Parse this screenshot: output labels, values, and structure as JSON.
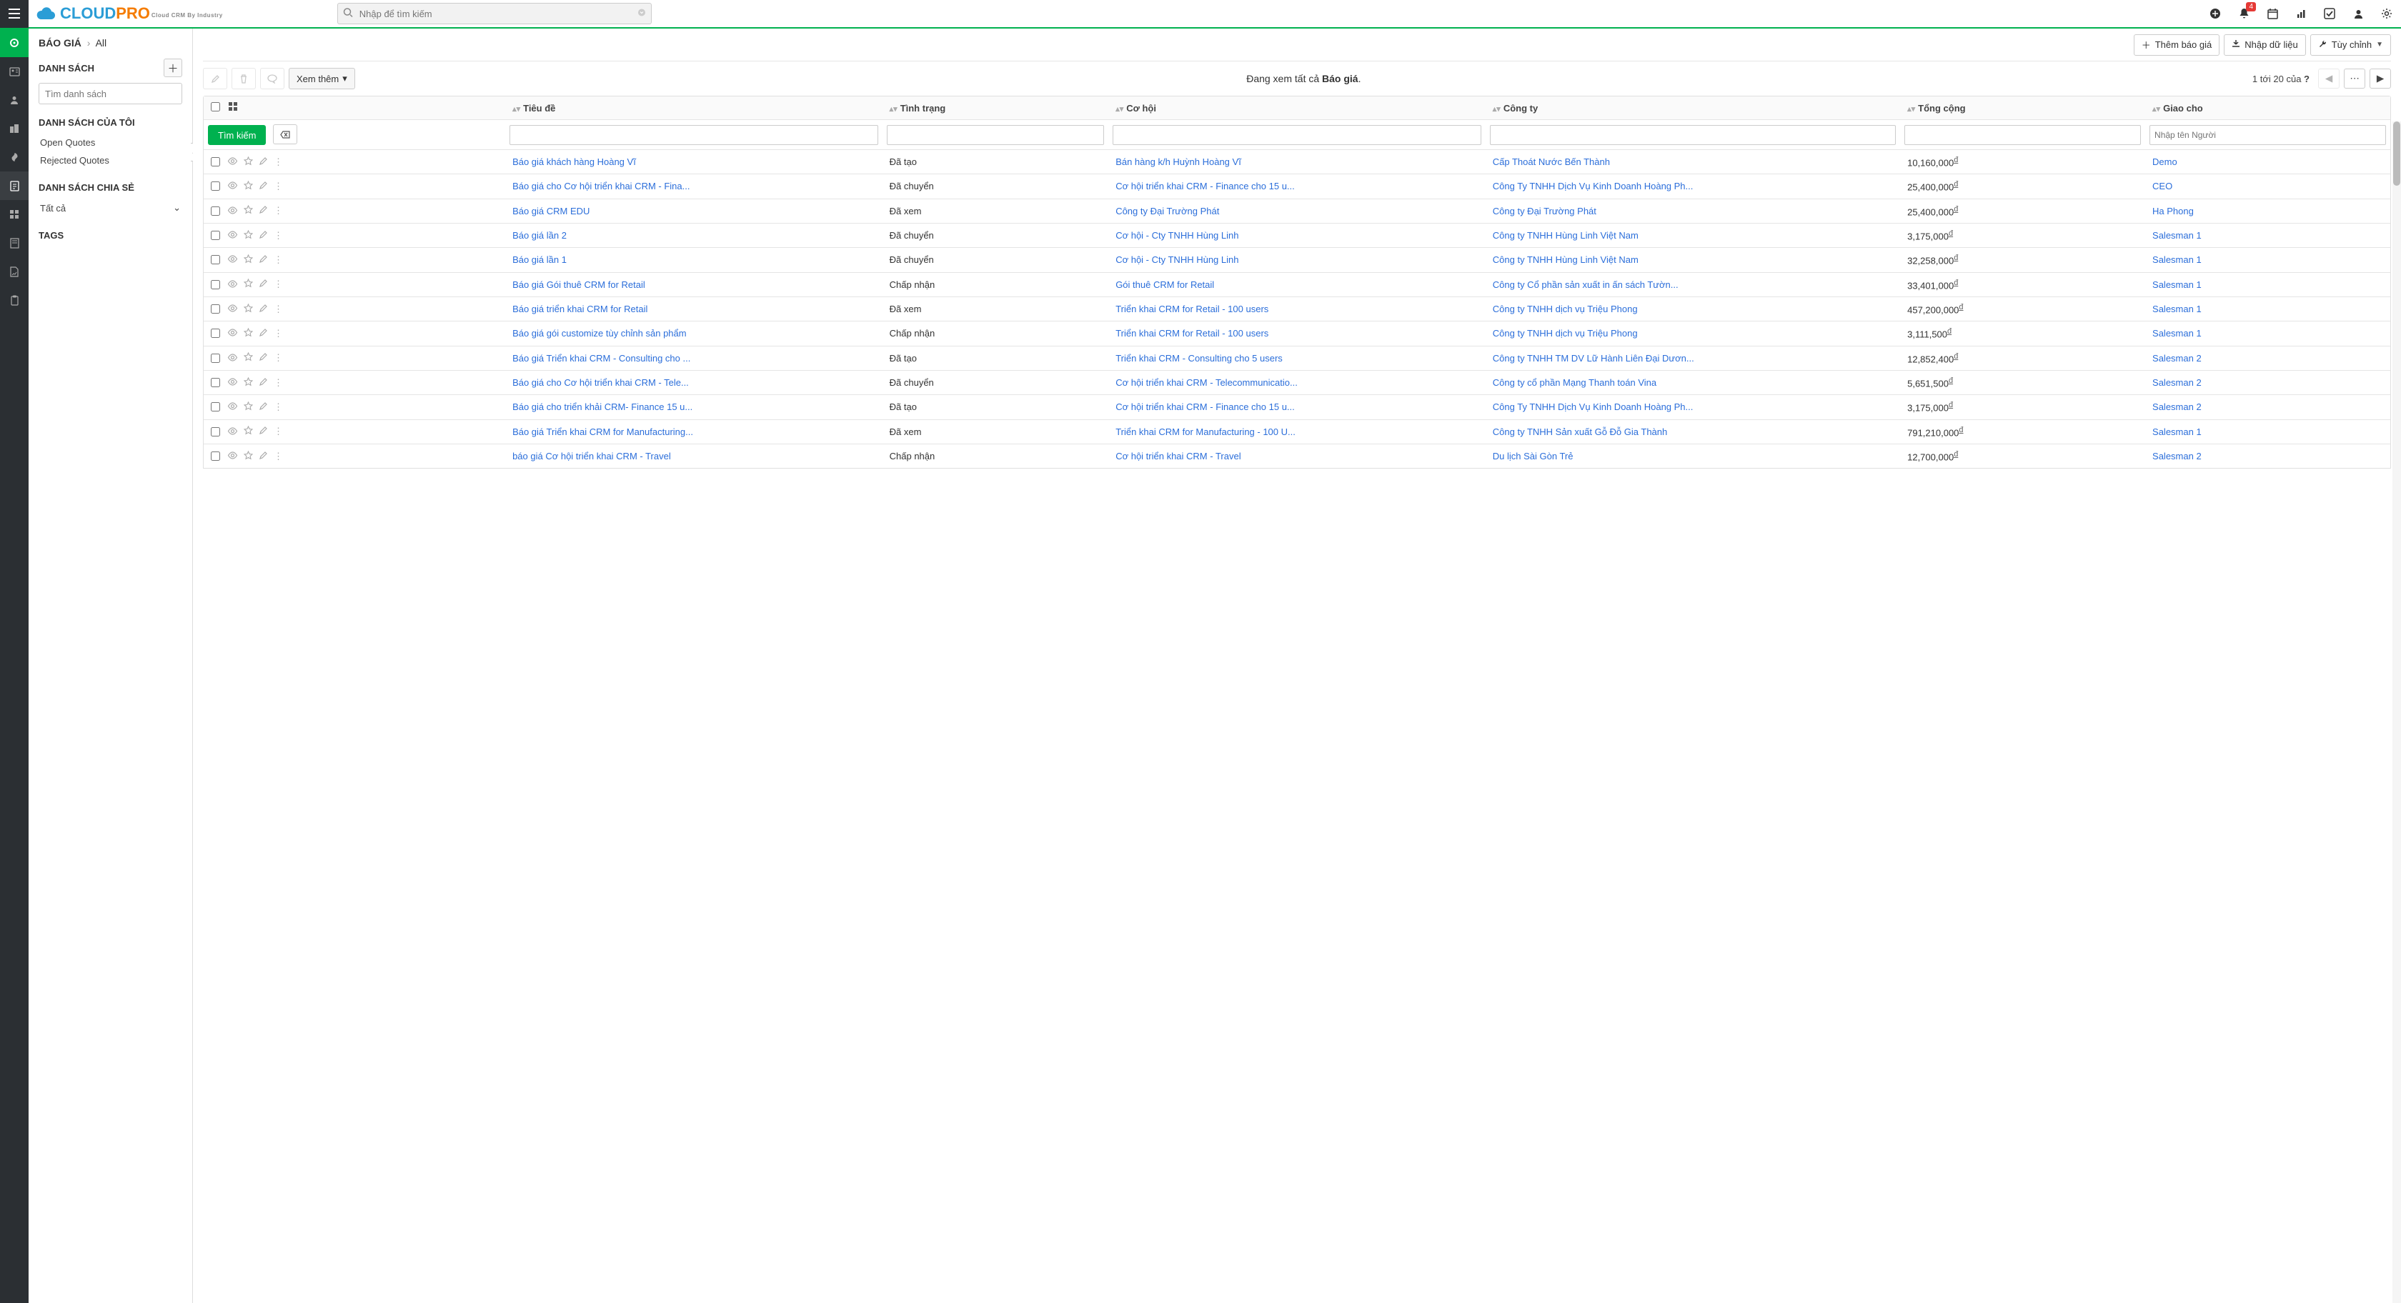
{
  "search": {
    "placeholder": "Nhập để tìm kiếm"
  },
  "notifications": {
    "count": "4"
  },
  "breadcrumb": {
    "module": "BÁO GIÁ",
    "view": "All"
  },
  "actions": {
    "add": "Thêm báo giá",
    "import": "Nhập dữ liệu",
    "customize": "Tùy chỉnh",
    "more": "Xem thêm"
  },
  "sidepanel": {
    "list_header": "DANH SÁCH",
    "search_placeholder": "Tìm danh sách",
    "my_lists_header": "DANH SÁCH CỦA TÔI",
    "my_lists": [
      "Open Quotes",
      "Rejected Quotes"
    ],
    "shared_header": "DANH SÁCH CHIA SẺ",
    "shared_value": "Tất cả",
    "tags_header": "TAGS"
  },
  "summary": {
    "prefix": "Đang xem tất cả ",
    "bold": "Báo giá",
    "suffix": "."
  },
  "pagination": {
    "text_prefix": "1 tới 20  của ",
    "text_suffix": "?"
  },
  "filter": {
    "search_btn": "Tìm kiếm",
    "assign_placeholder": "Nhập tên Người"
  },
  "columns": {
    "title": "Tiêu đề",
    "status": "Tình trạng",
    "opportunity": "Cơ hội",
    "company": "Công ty",
    "total": "Tổng cộng",
    "assigned": "Giao cho"
  },
  "rows": [
    {
      "title": "Báo giá khách hàng Hoàng Vĩ",
      "status": "Đã tạo",
      "opportunity": "Bán hàng k/h Huỳnh Hoàng Vĩ",
      "company": "Cấp Thoát Nước Bến Thành",
      "total": "10,160,000",
      "assigned": "Demo"
    },
    {
      "title": "Báo giá cho Cơ hội triển khai CRM - Fina...",
      "status": "Đã chuyển",
      "opportunity": "Cơ hội triển khai CRM - Finance cho 15 u...",
      "company": "Công Ty TNHH Dịch Vụ Kinh Doanh Hoàng Ph...",
      "total": "25,400,000",
      "assigned": "CEO"
    },
    {
      "title": "Báo giá CRM EDU",
      "status": "Đã xem",
      "opportunity": "Công ty Đại Trường Phát",
      "company": "Công ty Đại Trường Phát",
      "total": "25,400,000",
      "assigned": "Ha Phong"
    },
    {
      "title": "Báo giá lần 2",
      "status": "Đã chuyển",
      "opportunity": "Cơ hội - Cty TNHH Hùng Linh",
      "company": "Công ty TNHH Hùng Linh Việt Nam",
      "total": "3,175,000",
      "assigned": "Salesman 1"
    },
    {
      "title": "Báo giá lần 1",
      "status": "Đã chuyển",
      "opportunity": "Cơ hội - Cty TNHH Hùng Linh",
      "company": "Công ty TNHH Hùng Linh Việt Nam",
      "total": "32,258,000",
      "assigned": "Salesman 1"
    },
    {
      "title": "Báo giá Gói thuê CRM for Retail",
      "status": "Chấp nhận",
      "opportunity": "Gói thuê CRM for Retail",
      "company": "Công ty Cổ phần sản xuất in ấn sách Tườn...",
      "total": "33,401,000",
      "assigned": "Salesman 1"
    },
    {
      "title": "Báo giá triển khai CRM for Retail",
      "status": "Đã xem",
      "opportunity": "Triển khai CRM for Retail - 100 users",
      "company": "Công ty TNHH dịch vụ Triệu Phong",
      "total": "457,200,000",
      "assigned": "Salesman 1"
    },
    {
      "title": "Báo giá gói customize tùy chỉnh sản phẩm",
      "status": "Chấp nhận",
      "opportunity": "Triển khai CRM for Retail - 100 users",
      "company": "Công ty TNHH dịch vụ Triệu Phong",
      "total": "3,111,500",
      "assigned": "Salesman 1"
    },
    {
      "title": "Báo giá Triển khai CRM - Consulting cho ...",
      "status": "Đã tạo",
      "opportunity": "Triển khai CRM - Consulting cho 5 users",
      "company": "Công ty TNHH TM DV Lữ Hành Liên Đại Dươn...",
      "total": "12,852,400",
      "assigned": "Salesman 2"
    },
    {
      "title": "Báo giá cho Cơ hội triển khai CRM - Tele...",
      "status": "Đã chuyển",
      "opportunity": "Cơ hội triển khai CRM - Telecommunicatio...",
      "company": "Công ty cổ phần Mạng Thanh toán Vina",
      "total": "5,651,500",
      "assigned": "Salesman 2"
    },
    {
      "title": "Báo giá cho triển khải CRM- Finance 15 u...",
      "status": "Đã tạo",
      "opportunity": "Cơ hội triển khai CRM - Finance cho 15 u...",
      "company": "Công Ty TNHH Dịch Vụ Kinh Doanh Hoàng Ph...",
      "total": "3,175,000",
      "assigned": "Salesman 2"
    },
    {
      "title": "Báo giá Triển khai CRM for Manufacturing...",
      "status": "Đã xem",
      "opportunity": "Triển khai CRM for Manufacturing - 100 U...",
      "company": "Công ty TNHH Sản xuất Gỗ Đỗ Gia Thành",
      "total": "791,210,000",
      "assigned": "Salesman 1"
    },
    {
      "title": "báo giá Cơ hội triển khai CRM - Travel",
      "status": "Chấp nhận",
      "opportunity": "Cơ hội triển khai CRM - Travel",
      "company": "Du lịch Sài Gòn Trẻ",
      "total": "12,700,000",
      "assigned": "Salesman 2"
    }
  ]
}
